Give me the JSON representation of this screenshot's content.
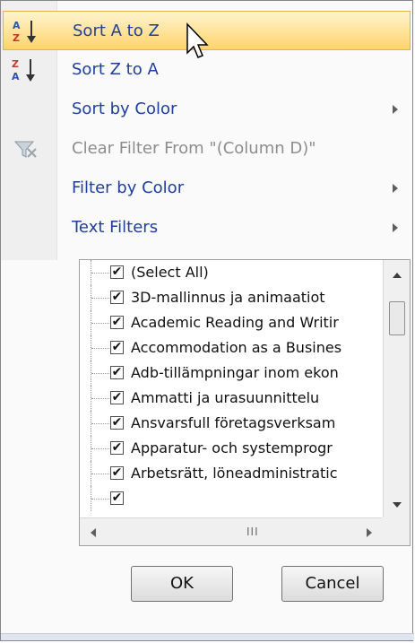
{
  "menu": {
    "items": [
      {
        "label": "Sort A to Z",
        "icon": "sort-az-icon",
        "hover": true
      },
      {
        "label": "Sort Z to A",
        "icon": "sort-za-icon"
      },
      {
        "label": "Sort by Color",
        "has_submenu": true
      },
      {
        "label": "Clear Filter From \"(Column D)\"",
        "icon": "clear-filter-icon",
        "disabled": true
      },
      {
        "label": "Filter by Color",
        "has_submenu": true
      },
      {
        "label": "Text Filters",
        "has_submenu": true
      }
    ]
  },
  "filter_list": {
    "items": [
      {
        "label": "(Select All)",
        "checked": true
      },
      {
        "label": "3D-mallinnus ja animaatiot",
        "checked": true
      },
      {
        "label": "Academic Reading and Writir",
        "checked": true
      },
      {
        "label": "Accommodation as a Busines",
        "checked": true
      },
      {
        "label": "Adb-tillämpningar inom ekon",
        "checked": true
      },
      {
        "label": "Ammatti ja urasuunnittelu",
        "checked": true
      },
      {
        "label": "Ansvarsfull företagsverksam",
        "checked": true
      },
      {
        "label": "Apparatur- och systemprogr",
        "checked": true
      },
      {
        "label": "Arbetsrätt, löneadministratic",
        "checked": true
      }
    ],
    "hscroll_grip": "III"
  },
  "buttons": {
    "ok_label": "OK",
    "cancel_label": "Cancel"
  },
  "colors": {
    "menu_text": "#1f3f9a",
    "hover_top": "#fff4cf",
    "hover_bottom": "#ffd36b",
    "disabled_text": "#8d8d8d"
  }
}
